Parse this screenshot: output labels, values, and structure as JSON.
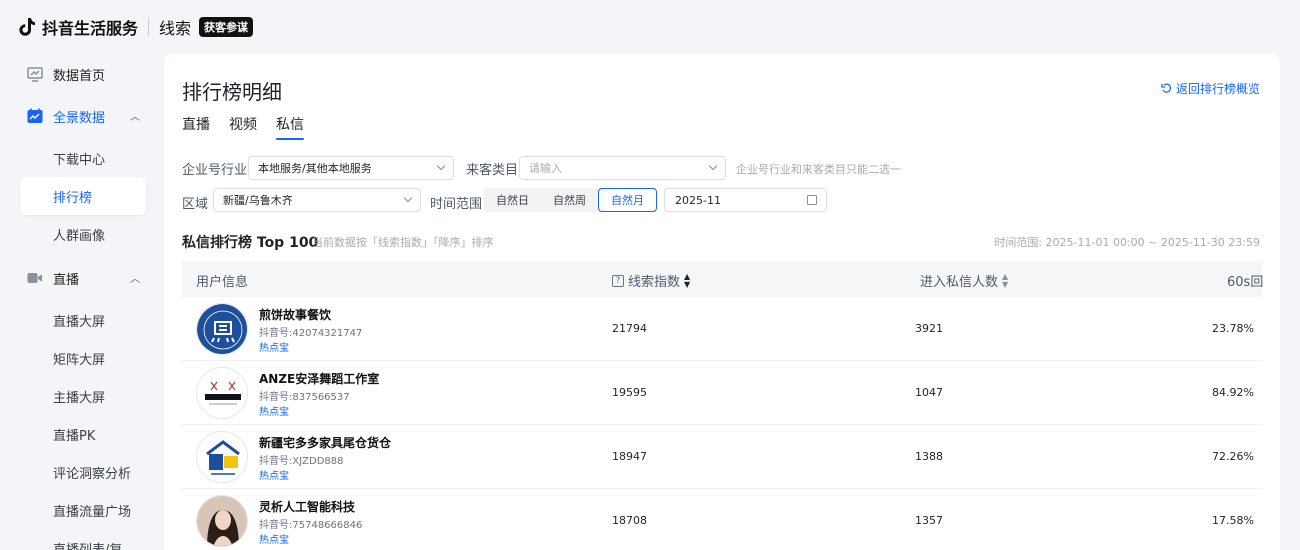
{
  "header": {
    "brand": "抖音生活服务",
    "section": "线索",
    "badge": "获客参谋"
  },
  "sidebar": {
    "items": [
      {
        "label": "数据首页",
        "icon": "dashboard-icon"
      },
      {
        "label": "全景数据",
        "icon": "panorama-icon",
        "expanded": true
      },
      {
        "label": "下载中心"
      },
      {
        "label": "排行榜",
        "selected": true
      },
      {
        "label": "人群画像"
      },
      {
        "label": "直播",
        "icon": "video-icon",
        "expanded": true
      },
      {
        "label": "直播大屏"
      },
      {
        "label": "矩阵大屏"
      },
      {
        "label": "主播大屏"
      },
      {
        "label": "直播PK"
      },
      {
        "label": "评论洞察分析"
      },
      {
        "label": "直播流量广场"
      },
      {
        "label": "直播列表/复"
      }
    ]
  },
  "main": {
    "title": "排行榜明细",
    "back_link": "返回排行榜概览",
    "tabs": [
      "直播",
      "视频",
      "私信"
    ],
    "active_tab": "私信",
    "filters": {
      "industry_label": "企业号行业",
      "industry_value": "本地服务/其他本地服务",
      "category_label": "来客类目",
      "category_placeholder": "请输入",
      "hint": "企业号行业和来客类目只能二选一",
      "region_label": "区域",
      "region_value": "新疆/乌鲁木齐",
      "time_label": "时间范围",
      "time_options": [
        "自然日",
        "自然周",
        "自然月"
      ],
      "time_selected": "自然月",
      "date_value": "2025-11"
    },
    "section": {
      "title": "私信排行榜 Top 100",
      "note": "当前数据按「线索指数」「降序」排序",
      "range": "时间范围: 2025-11-01 00:00 ~ 2025-11-30 23:59"
    },
    "table": {
      "columns": [
        "用户信息",
        "线索指数",
        "进入私信人数",
        "60s回"
      ],
      "rows": [
        {
          "name": "煎饼故事餐饮",
          "douyin_id": "抖音号:42074321747",
          "tag": "热点宝",
          "index": "21794",
          "entries": "3921",
          "rate": "23.78%"
        },
        {
          "name": "ANZE安泽舞蹈工作室",
          "douyin_id": "抖音号:837566537",
          "tag": "热点宝",
          "index": "19595",
          "entries": "1047",
          "rate": "84.92%"
        },
        {
          "name": "新疆宅多多家具尾仓货仓",
          "douyin_id": "抖音号:XJZDD888",
          "tag": "热点宝",
          "index": "18947",
          "entries": "1388",
          "rate": "72.26%"
        },
        {
          "name": "灵析人工智能科技",
          "douyin_id": "抖音号:75748666846",
          "tag": "热点宝",
          "index": "18708",
          "entries": "1357",
          "rate": "17.58%"
        }
      ]
    }
  },
  "colors": {
    "accent": "#1664ff",
    "background": "#f3f5f8"
  }
}
